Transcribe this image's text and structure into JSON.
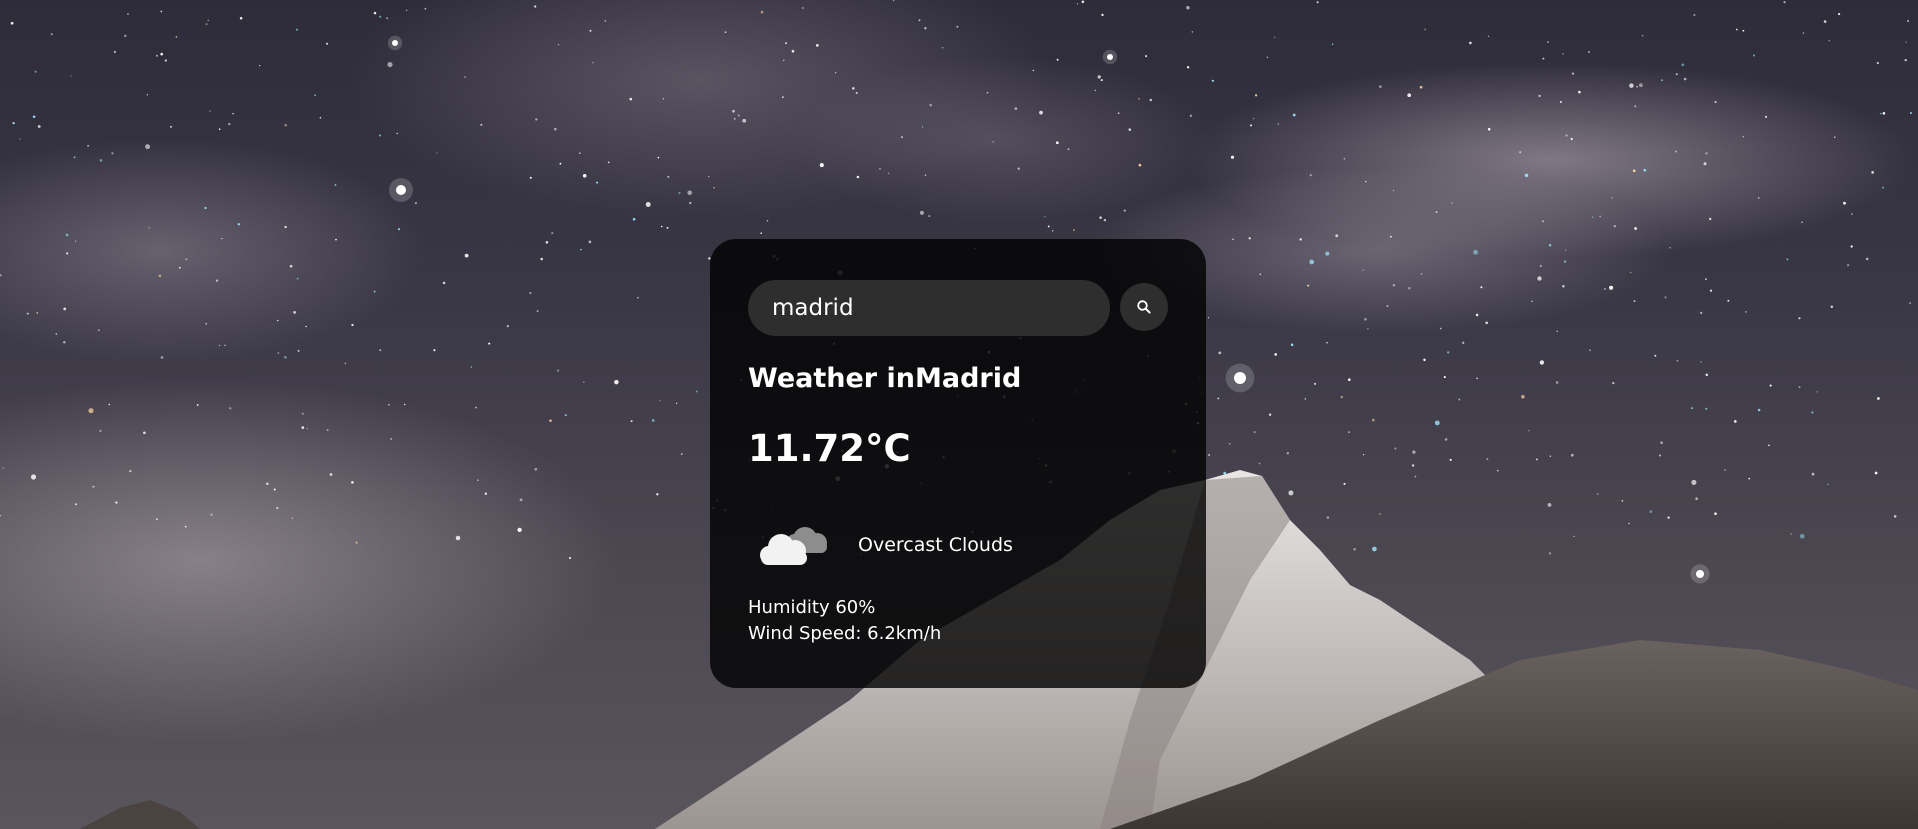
{
  "search": {
    "value": "madrid",
    "button_icon": "search-icon"
  },
  "weather": {
    "city_prefix": "Weather in",
    "city": "Madrid",
    "temperature": "11.72°C",
    "icon": "overcast-clouds-icon",
    "description": "Overcast Clouds",
    "humidity": "Humidity 60%",
    "wind": "Wind Speed: 6.2km/h"
  },
  "background": {
    "subject": "starry-night-mountain-photo"
  }
}
